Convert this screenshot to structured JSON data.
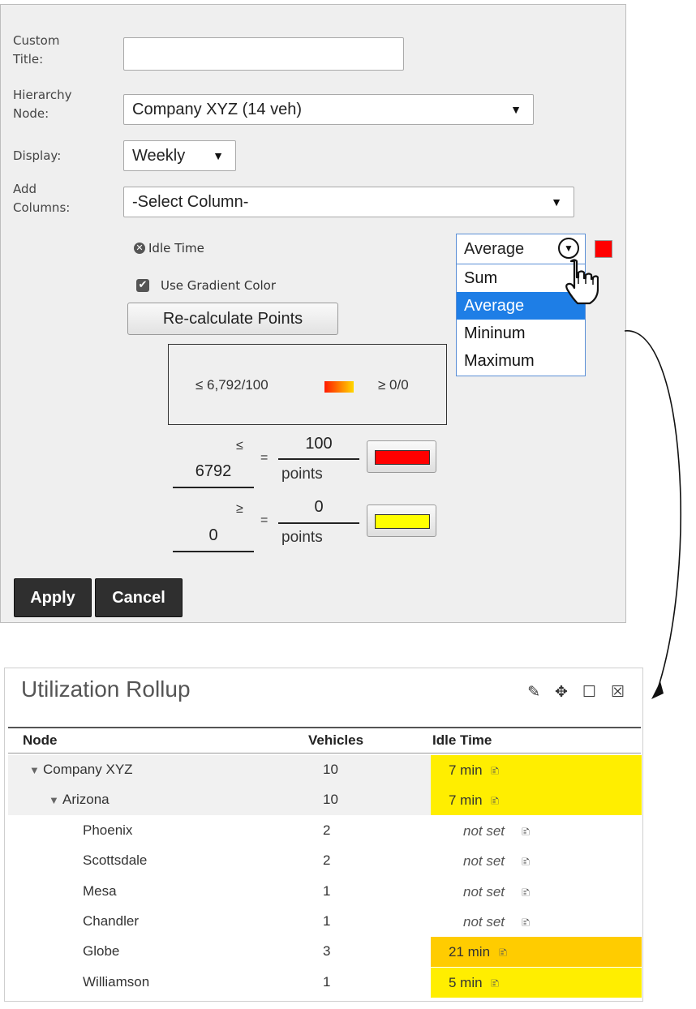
{
  "form": {
    "custom_title_label": "Custom\nTitle:",
    "custom_title_value": "",
    "hierarchy_label": "Hierarchy\nNode:",
    "hierarchy_value": "Company XYZ (14 veh)",
    "display_label": "Display:",
    "display_value": "Weekly",
    "add_columns_label": "Add\nColumns:",
    "add_columns_value": "-Select Column-",
    "arrow_glyph": "▼"
  },
  "column": {
    "name": "Idle Time",
    "remove_glyph": "✕",
    "use_gradient_label": "Use Gradient Color",
    "checkbox_glyph": "✔",
    "recalc_label": "Re-calculate Points",
    "aggregate_value": "Average",
    "aggregate_options": [
      "Sum",
      "Average",
      "Mininum",
      "Maximum"
    ],
    "aggregate_selected": "Average",
    "swatch_color": "#ff0000"
  },
  "legend": {
    "left": "≤ 6,792/100",
    "right": "≥ 0/0",
    "gradient_from": "#ff1a00",
    "gradient_to": "#ffd800"
  },
  "thresholds": {
    "high_symbol": "≤",
    "high_value": "6792",
    "high_points": "100",
    "high_color": "#ff0000",
    "low_symbol": "≥",
    "low_value": "0",
    "low_points": "0",
    "low_color": "#ffff00",
    "equals": "=",
    "points_label": "points"
  },
  "buttons": {
    "apply": "Apply",
    "cancel": "Cancel"
  },
  "widget": {
    "title": "Utilization Rollup",
    "icons": [
      "pencil-icon",
      "move-icon",
      "maximize-icon",
      "close-icon"
    ],
    "icon_glyphs": [
      "✎",
      "✥",
      "☐",
      "☒"
    ],
    "columns": [
      "Node",
      "Vehicles",
      "Idle Time"
    ],
    "rows": [
      {
        "node": "Company XYZ",
        "expander": "▼",
        "vehicles": "10",
        "idle": "7 min",
        "color": "#ffee00"
      },
      {
        "node": "Arizona",
        "expander": "▼",
        "vehicles": "10",
        "idle": "7 min",
        "color": "#ffee00"
      },
      {
        "node": "Phoenix",
        "expander": "",
        "vehicles": "2",
        "idle": "not set",
        "color": ""
      },
      {
        "node": "Scottsdale",
        "expander": "",
        "vehicles": "2",
        "idle": "not set",
        "color": ""
      },
      {
        "node": "Mesa",
        "expander": "",
        "vehicles": "1",
        "idle": "not set",
        "color": ""
      },
      {
        "node": "Chandler",
        "expander": "",
        "vehicles": "1",
        "idle": "not set",
        "color": ""
      },
      {
        "node": "Globe",
        "expander": "",
        "vehicles": "3",
        "idle": "21 min",
        "color": "#ffcc00"
      },
      {
        "node": "Williamson",
        "expander": "",
        "vehicles": "1",
        "idle": "5 min",
        "color": "#ffee00"
      }
    ],
    "note_glyph": "🗈"
  }
}
